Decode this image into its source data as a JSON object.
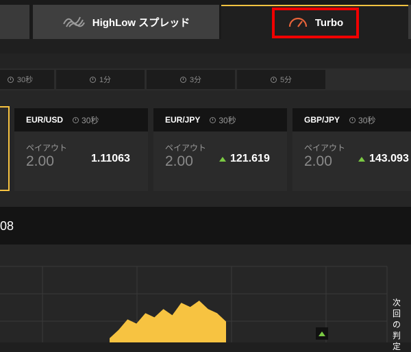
{
  "tabs": {
    "highlow_spread_label": "HighLow スプレッド",
    "turbo_label": "Turbo"
  },
  "durations": [
    "30秒",
    "1分",
    "3分",
    "5分"
  ],
  "cards": [
    {
      "pair": "EUR/USD",
      "expiry": "30秒",
      "payout_label": "ペイアウト",
      "payout": "2.00",
      "price": "1.11063",
      "trend": "none"
    },
    {
      "pair": "EUR/JPY",
      "expiry": "30秒",
      "payout_label": "ペイアウト",
      "payout": "2.00",
      "price": "121.619",
      "trend": "up"
    },
    {
      "pair": "GBP/JPY",
      "expiry": "30秒",
      "payout_label": "ペイアウト",
      "payout": "2.00",
      "price": "143.093",
      "trend": "up"
    }
  ],
  "chart": {
    "header_value_fragment": "08",
    "side_label": "次回の判定",
    "chart_data": {
      "type": "area",
      "color": "#f7c341",
      "values": [
        0.1,
        0.3,
        0.55,
        0.45,
        0.7,
        0.6,
        0.8,
        0.65,
        0.95,
        0.85,
        1.0,
        0.8,
        0.7,
        0.5
      ]
    }
  },
  "colors": {
    "accent": "#f7c341",
    "highlight_box": "#f00000",
    "up": "#7ac943",
    "turbo_icon": "#e8643a"
  }
}
